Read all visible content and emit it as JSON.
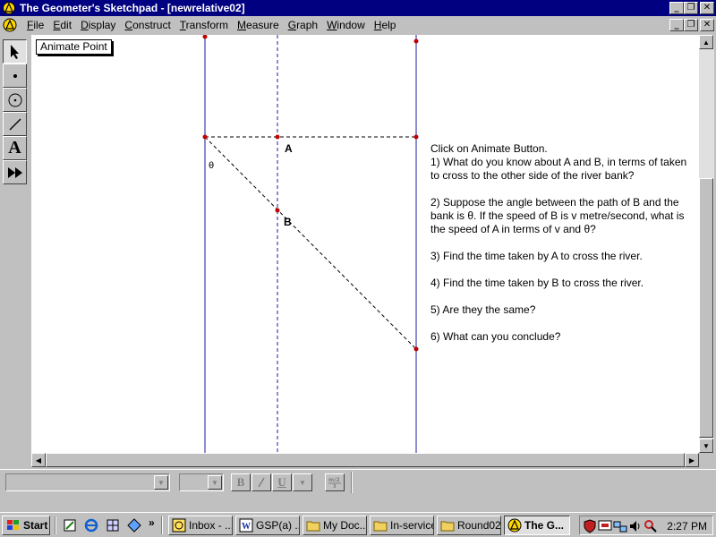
{
  "window": {
    "title": "The Geometer's Sketchpad - [newrelative02]",
    "controls": [
      "_",
      "❐",
      "✕"
    ]
  },
  "menu": {
    "items": [
      {
        "key": "F",
        "rest": "ile"
      },
      {
        "key": "E",
        "rest": "dit"
      },
      {
        "key": "D",
        "rest": "isplay"
      },
      {
        "key": "C",
        "rest": "onstruct"
      },
      {
        "key": "T",
        "rest": "ransform"
      },
      {
        "key": "M",
        "rest": "easure"
      },
      {
        "key": "G",
        "rest": "raph"
      },
      {
        "key": "W",
        "rest": "indow"
      },
      {
        "key": "H",
        "rest": "elp"
      }
    ]
  },
  "toolbox": {
    "tools": [
      "selection-arrow-tool",
      "point-tool",
      "compass-tool",
      "straightedge-tool",
      "text-tool",
      "script-tool"
    ],
    "text_tool_glyph": "A"
  },
  "sketch": {
    "animate_button_label": "Animate Point",
    "point_a_label": "A",
    "point_b_label": "B",
    "angle_label": "θ",
    "instructions": {
      "intro": "Click on Animate Button.",
      "q1": "1)  What do you know about A and B, in terms of taken to cross to the other side of the river bank?",
      "q2": "2) Suppose the angle between the path of B and the bank is θ. If the speed of B is v  metre/second, what is the speed of A in terms of v and θ?",
      "q3": "3) Find the time taken by A to cross the river.",
      "q4": "4) Find the time taken by B to cross the river.",
      "q5": "5) Are they the same?",
      "q6": "6) What can you conclude?"
    }
  },
  "text_palette": {
    "bold": "B",
    "italic": "I",
    "underline": "U",
    "color_arrow": "▼"
  },
  "taskbar": {
    "start_label": "Start",
    "quicklaunch_more": "»",
    "tasks": [
      {
        "label": "Inbox - ...",
        "icon": "outlook-icon",
        "active": false
      },
      {
        "label": "GSP(a) ...",
        "icon": "word-doc-icon",
        "active": false
      },
      {
        "label": "My Doc...",
        "icon": "folder-icon",
        "active": false
      },
      {
        "label": "In-service",
        "icon": "folder-icon",
        "active": false
      },
      {
        "label": "Round02",
        "icon": "folder-icon",
        "active": false
      },
      {
        "label": "The G...",
        "icon": "sketchpad-icon",
        "active": true
      }
    ],
    "clock": "2:27 PM"
  },
  "colors": {
    "titlebar": "#000080",
    "line_blue": "#1a1aa0",
    "point_red": "#c00000",
    "face": "#c0c0c0"
  }
}
